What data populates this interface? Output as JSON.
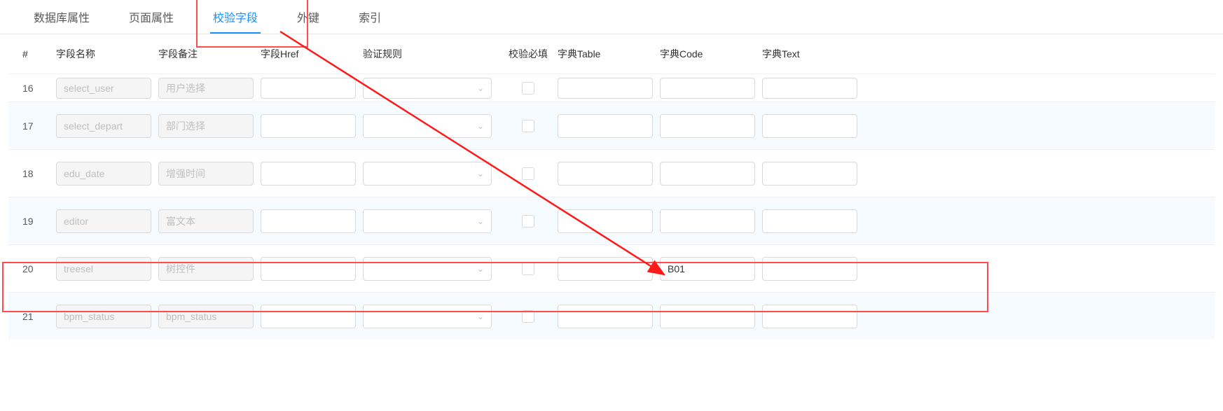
{
  "tabs": [
    {
      "label": "数据库属性",
      "active": false
    },
    {
      "label": "页面属性",
      "active": false
    },
    {
      "label": "校验字段",
      "active": true
    },
    {
      "label": "外键",
      "active": false
    },
    {
      "label": "索引",
      "active": false
    }
  ],
  "columns": {
    "idx": "#",
    "name": "字段名称",
    "remark": "字段备注",
    "href": "字段Href",
    "rule": "验证规则",
    "req": "校验必填",
    "table": "字典Table",
    "code": "字典Code",
    "text": "字典Text"
  },
  "rows": [
    {
      "idx": "16",
      "name": "select_user",
      "remark": "用户选择",
      "href": "",
      "rule": "",
      "req": false,
      "table": "",
      "code": "",
      "text": ""
    },
    {
      "idx": "17",
      "name": "select_depart",
      "remark": "部门选择",
      "href": "",
      "rule": "",
      "req": false,
      "table": "",
      "code": "",
      "text": ""
    },
    {
      "idx": "18",
      "name": "edu_date",
      "remark": "增强时间",
      "href": "",
      "rule": "",
      "req": false,
      "table": "",
      "code": "",
      "text": ""
    },
    {
      "idx": "19",
      "name": "editor",
      "remark": "富文本",
      "href": "",
      "rule": "",
      "req": false,
      "table": "",
      "code": "",
      "text": ""
    },
    {
      "idx": "20",
      "name": "treesel",
      "remark": "树控件",
      "href": "",
      "rule": "",
      "req": false,
      "table": "",
      "code": "B01",
      "text": ""
    },
    {
      "idx": "21",
      "name": "bpm_status",
      "remark": "bpm_status",
      "href": "",
      "rule": "",
      "req": false,
      "table": "",
      "code": "",
      "text": ""
    }
  ],
  "annotations": {
    "tab_box": true,
    "row_box_target_idx": "20",
    "arrow_from": "active-tab",
    "arrow_to": "row-20-code"
  }
}
